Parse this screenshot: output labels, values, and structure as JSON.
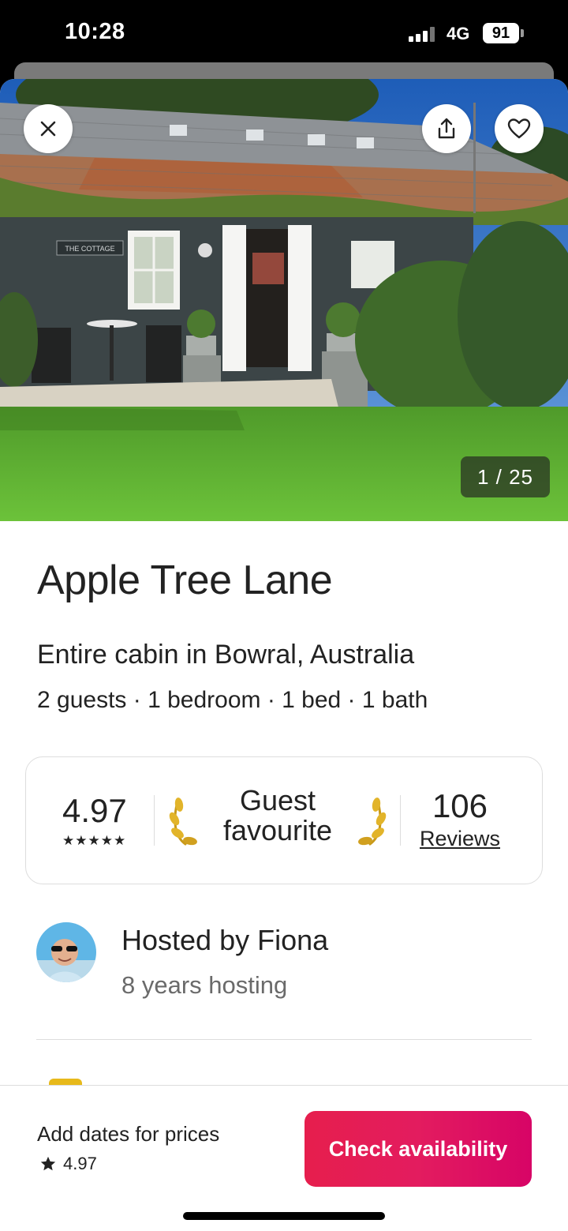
{
  "status_bar": {
    "time": "10:28",
    "network": "4G",
    "battery": "91"
  },
  "hero": {
    "photo_counter": "1 / 25",
    "close_icon": "close-icon",
    "share_icon": "share-icon",
    "favorite_icon": "heart-icon"
  },
  "listing": {
    "title": "Apple Tree Lane",
    "subtitle": "Entire cabin in Bowral, Australia",
    "details": "2 guests · 1 bedroom · 1 bed · 1 bath"
  },
  "rating_box": {
    "rating": "4.97",
    "stars": "★★★★★",
    "badge": "Guest favourite",
    "reviews_count": "106",
    "reviews_label": "Reviews"
  },
  "host": {
    "name": "Hosted by Fiona",
    "years": "8 years hosting"
  },
  "footer": {
    "prompt": "Add dates for prices",
    "rating": "4.97",
    "cta": "Check availability"
  },
  "colors": {
    "accent": "#E31C5F",
    "text": "#222222",
    "muted": "#6A6A6A",
    "border": "#DDDDDD",
    "gold": "#E7B91B"
  }
}
